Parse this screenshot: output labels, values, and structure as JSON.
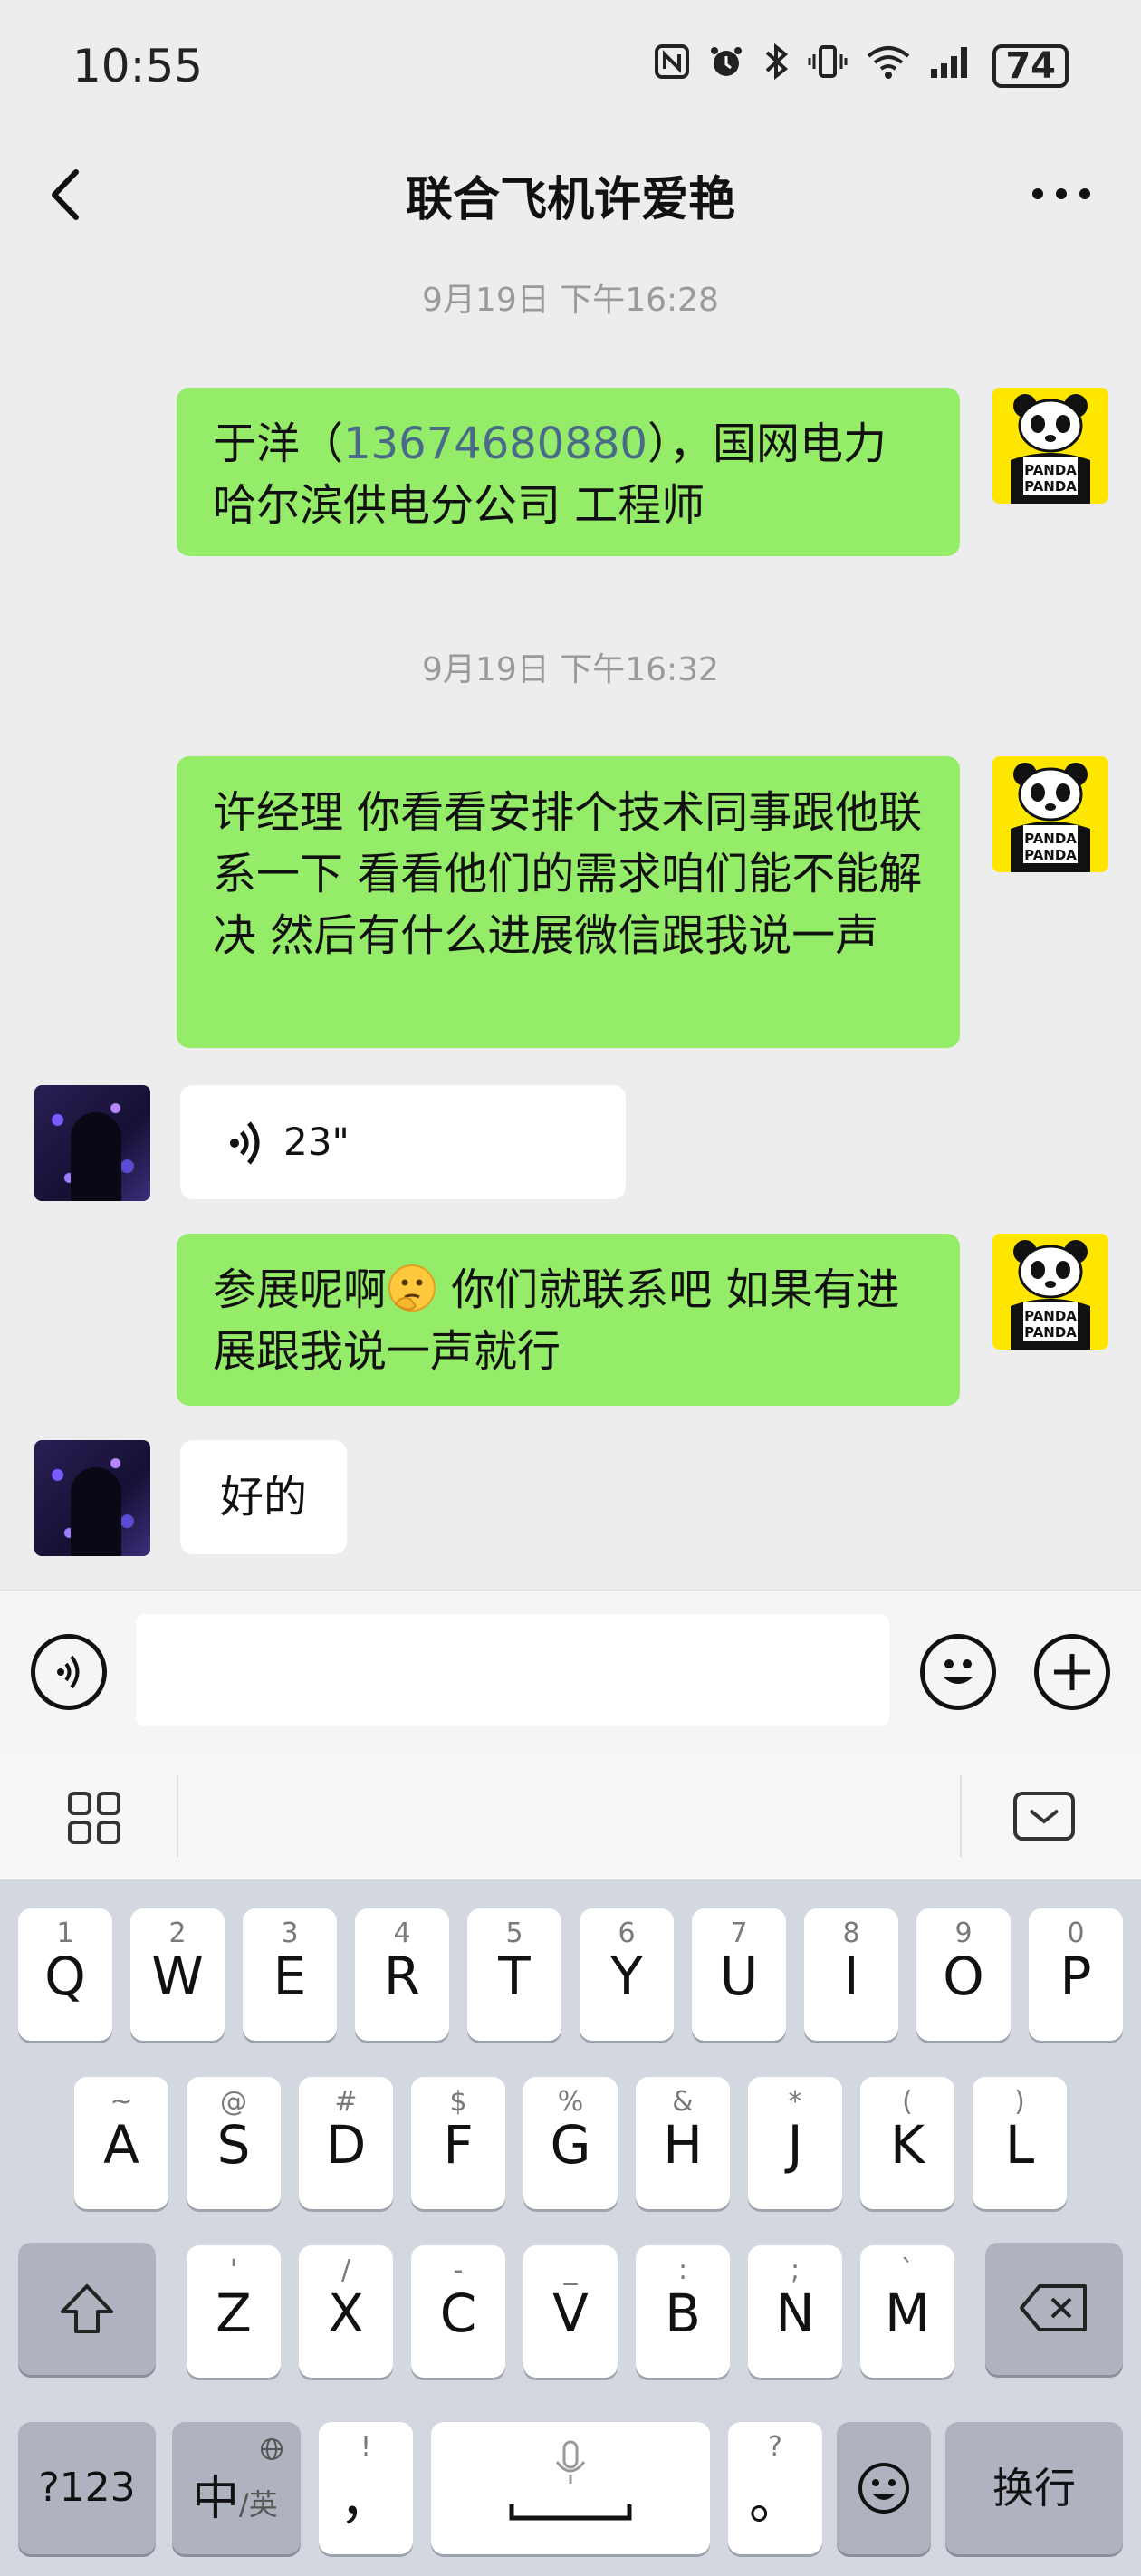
{
  "status": {
    "time": "10:55",
    "battery": "74",
    "icons": [
      "nfc-icon",
      "alarm-icon",
      "bluetooth-icon",
      "vibrate-icon",
      "wifi-icon",
      "signal-icon"
    ]
  },
  "nav": {
    "title": "联合飞机许爱艳"
  },
  "messages": {
    "ts1": "9月19日 下午16:28",
    "m1_pre": "于洋（",
    "m1_phone": "13674680880",
    "m1_post": "），国网电力哈尔滨供电分公司 工程师",
    "ts2": "9月19日 下午16:32",
    "m2": "许经理 你看看安排个技术同事跟他联系一下 看看他们的需求咱们能不能解决 然后有什么进展微信跟我说一声",
    "voice_duration": "23\"",
    "m3_pre": "参展呢啊",
    "m3_post": " 你们就联系吧 如果有进展跟我说一声就行",
    "m4": "好的",
    "panda_text1": "PANDA",
    "panda_text2": "PANDA"
  },
  "keyboard": {
    "row1": [
      {
        "main": "Q",
        "sub": "1"
      },
      {
        "main": "W",
        "sub": "2"
      },
      {
        "main": "E",
        "sub": "3"
      },
      {
        "main": "R",
        "sub": "4"
      },
      {
        "main": "T",
        "sub": "5"
      },
      {
        "main": "Y",
        "sub": "6"
      },
      {
        "main": "U",
        "sub": "7"
      },
      {
        "main": "I",
        "sub": "8"
      },
      {
        "main": "O",
        "sub": "9"
      },
      {
        "main": "P",
        "sub": "0"
      }
    ],
    "row2": [
      {
        "main": "A",
        "sub": "~"
      },
      {
        "main": "S",
        "sub": "@"
      },
      {
        "main": "D",
        "sub": "#"
      },
      {
        "main": "F",
        "sub": "$"
      },
      {
        "main": "G",
        "sub": "%"
      },
      {
        "main": "H",
        "sub": "&"
      },
      {
        "main": "J",
        "sub": "*"
      },
      {
        "main": "K",
        "sub": "("
      },
      {
        "main": "L",
        "sub": ")"
      }
    ],
    "row3": [
      {
        "main": "Z",
        "sub": "'"
      },
      {
        "main": "X",
        "sub": "/"
      },
      {
        "main": "C",
        "sub": "-"
      },
      {
        "main": "V",
        "sub": "_"
      },
      {
        "main": "B",
        "sub": ":"
      },
      {
        "main": "N",
        "sub": ";"
      },
      {
        "main": "M",
        "sub": "`"
      }
    ],
    "sym_label": "?123",
    "lang_main": "中",
    "lang_sub": "/英",
    "comma_main": "，",
    "comma_sub": "!",
    "period_main": "。",
    "period_sub": "?",
    "enter_label": "换行"
  }
}
